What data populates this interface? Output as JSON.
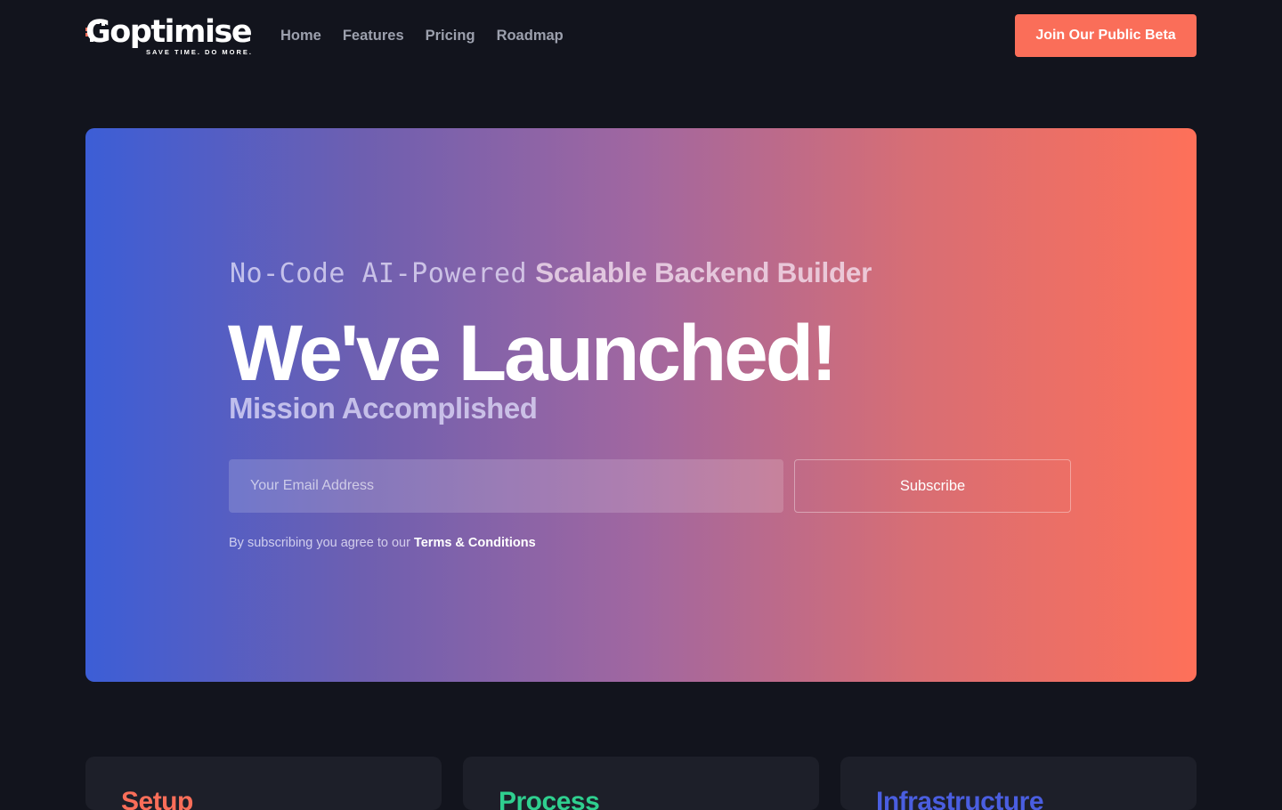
{
  "nav": {
    "logo_text": "Goptimise",
    "logo_tagline": "SAVE TIME. DO MORE.",
    "links": [
      {
        "label": "Home"
      },
      {
        "label": "Features"
      },
      {
        "label": "Pricing"
      },
      {
        "label": "Roadmap"
      }
    ],
    "cta_label": "Join Our Public Beta"
  },
  "hero": {
    "eyebrow_mono": "No-Code AI-Powered",
    "eyebrow_bold": "Scalable Backend Builder",
    "headline": "We've Launched!",
    "subhead": "Mission Accomplished",
    "email_placeholder": "Your Email Address",
    "subscribe_label": "Subscribe",
    "terms_prefix": "By subscribing you agree to our",
    "terms_link": "Terms & Conditions"
  },
  "cards": [
    {
      "title": "Setup",
      "color": "#fa6e59"
    },
    {
      "title": "Process",
      "color": "#2fcf8f"
    },
    {
      "title": "Infrastructure",
      "color": "#4a5ee0"
    }
  ],
  "colors": {
    "background": "#12141d",
    "accent": "#fa6e59",
    "gradient_start": "#3c5ed6",
    "gradient_end": "#fe7059",
    "card_bg": "#1d1f29"
  }
}
